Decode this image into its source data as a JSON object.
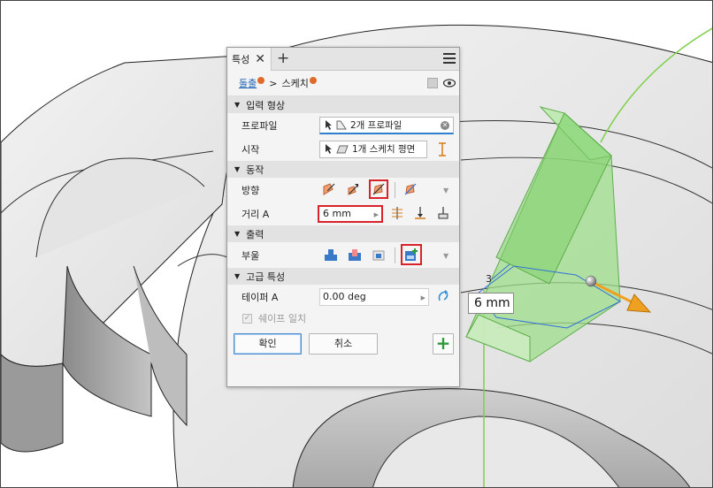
{
  "viewport": {
    "dimension_value": "6 mm",
    "small_dimension": "3"
  },
  "panel": {
    "tab_label": "특성",
    "tab_close": "✕",
    "tab_add": "+",
    "breadcrumb": {
      "parent": "돌출",
      "separator": ">",
      "current": "스케치"
    },
    "sections": {
      "input": {
        "title": "입력 형상",
        "profile_label": "프로파일",
        "profile_value": "2개 프로파일",
        "start_label": "시작",
        "start_value": "1개 스케치 평면"
      },
      "behavior": {
        "title": "동작",
        "direction_label": "방향",
        "distance_label": "거리 A",
        "distance_value": "6 mm"
      },
      "output": {
        "title": "출력",
        "boolean_label": "부울"
      },
      "advanced": {
        "title": "고급 특성",
        "taper_label": "테이퍼 A",
        "taper_value": "0.00 deg",
        "match_shape_label": "쉐이프 일치"
      }
    },
    "buttons": {
      "ok": "확인",
      "cancel": "취소",
      "apply": "+"
    }
  },
  "colors": {
    "accent_red": "#d8232a",
    "preview_green": "#8fd47e",
    "arrow_orange": "#f0a020",
    "link_blue": "#1a62b3"
  }
}
